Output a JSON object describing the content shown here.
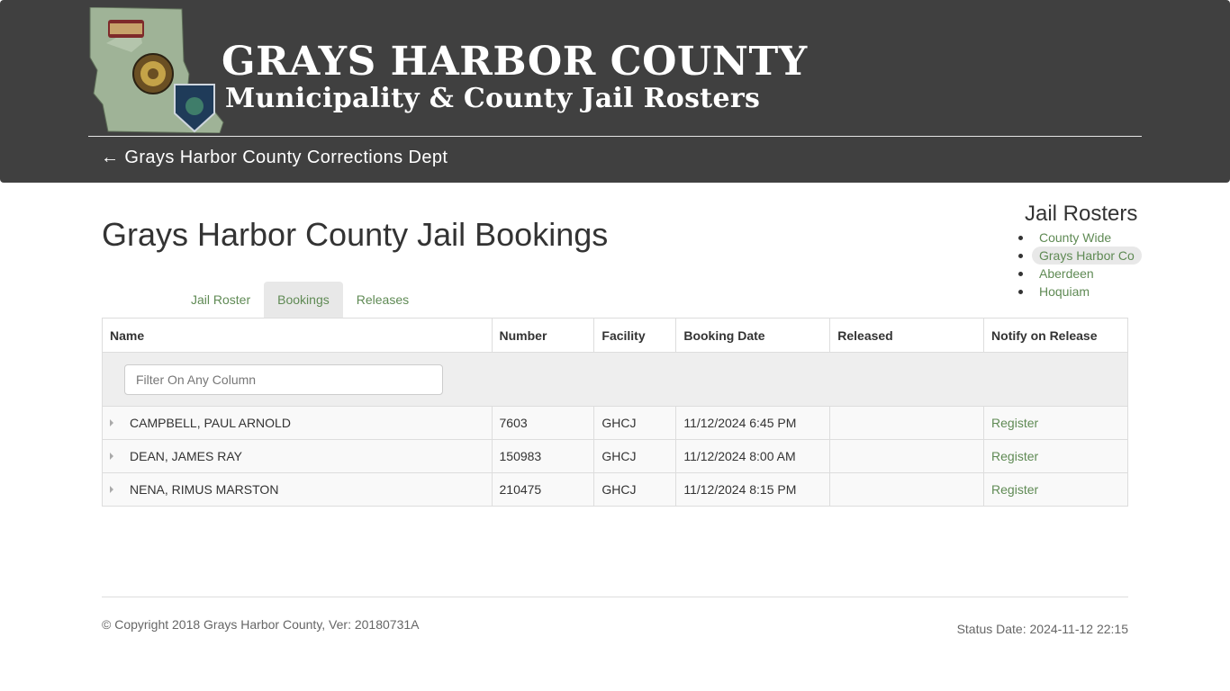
{
  "header": {
    "title": "GRAYS HARBOR COUNTY",
    "subtitle": "Municipality & County Jail Rosters",
    "back_arrow": "←",
    "back_link": "Grays Harbor County Corrections Dept",
    "logo_icon": "county-map-with-badges-icon"
  },
  "page": {
    "title": "Grays Harbor County Jail Bookings"
  },
  "side_nav": {
    "title": "Jail Rosters",
    "items": [
      {
        "label": "County Wide",
        "active": false
      },
      {
        "label": "Grays Harbor Co",
        "active": true
      },
      {
        "label": "Aberdeen",
        "active": false
      },
      {
        "label": "Hoquiam",
        "active": false
      }
    ]
  },
  "tabs": [
    {
      "label": "Jail Roster",
      "active": false
    },
    {
      "label": "Bookings",
      "active": true
    },
    {
      "label": "Releases",
      "active": false
    }
  ],
  "table": {
    "columns": [
      "Name",
      "Number",
      "Facility",
      "Booking Date",
      "Released",
      "Notify on Release"
    ],
    "filter_placeholder": "Filter On Any Column",
    "rows": [
      {
        "name": "CAMPBELL, PAUL ARNOLD",
        "number": "7603",
        "facility": "GHCJ",
        "booking_date": "11/12/2024 6:45 PM",
        "released": "",
        "notify": "Register"
      },
      {
        "name": "DEAN, JAMES RAY",
        "number": "150983",
        "facility": "GHCJ",
        "booking_date": "11/12/2024 8:00 AM",
        "released": "",
        "notify": "Register"
      },
      {
        "name": "NENA, RIMUS MARSTON",
        "number": "210475",
        "facility": "GHCJ",
        "booking_date": "11/12/2024 8:15 PM",
        "released": "",
        "notify": "Register"
      }
    ]
  },
  "footer": {
    "copyright": "© Copyright 2018 Grays Harbor County, Ver: 20180731A",
    "status_date": "Status Date: 2024-11-12 22:15"
  },
  "colors": {
    "header_bg": "#404040",
    "link": "#5f8a54",
    "active_tab_bg": "#e8e8e8",
    "filter_row_bg": "#eeeeee"
  }
}
